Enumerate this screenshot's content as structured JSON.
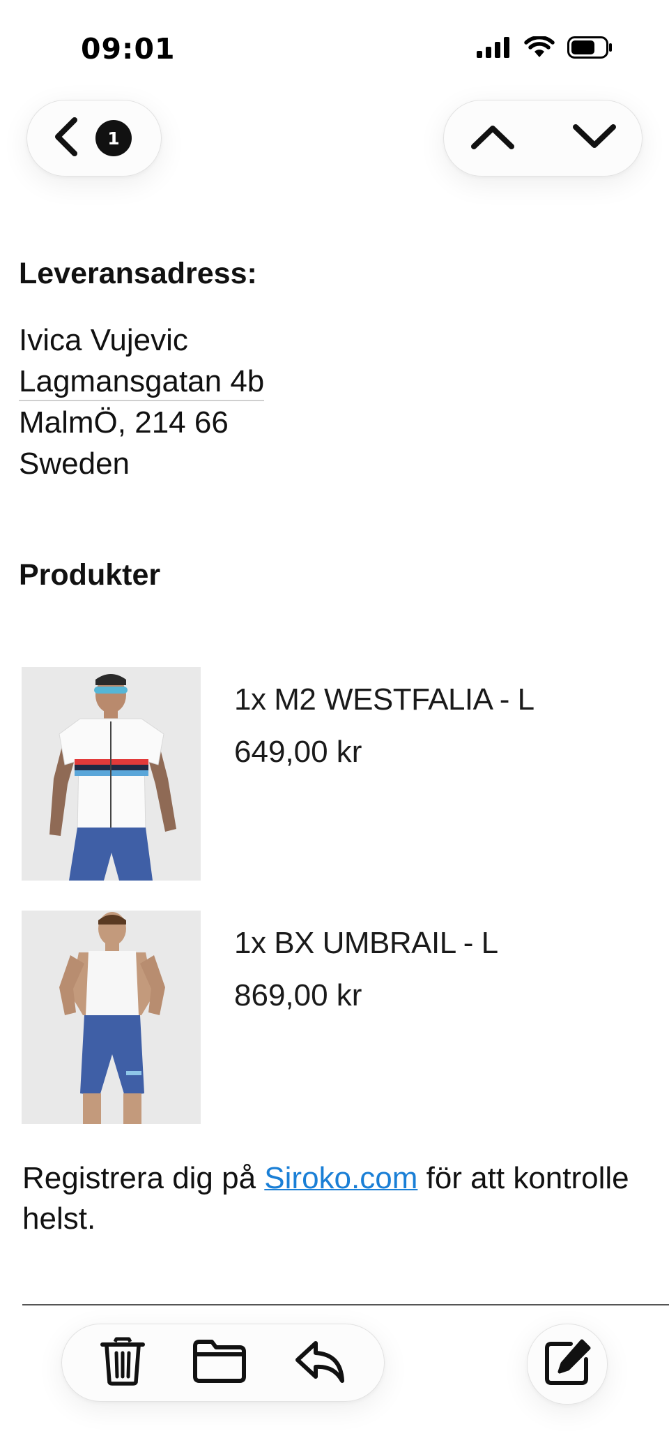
{
  "status_bar": {
    "time": "09:01"
  },
  "nav": {
    "back_icon": "chevron-left-icon",
    "unread_count": "1",
    "prev_icon": "chevron-up-icon",
    "next_icon": "chevron-down-icon"
  },
  "shipping": {
    "heading": "Leveransadress:",
    "name": "Ivica Vujevic",
    "street": "Lagmansgatan 4b",
    "city_zip": "MalmÖ, 214 66",
    "country": "Sweden"
  },
  "products": {
    "heading": "Produkter",
    "items": [
      {
        "title": "1x M2 WESTFALIA - L",
        "price": "649,00 kr"
      },
      {
        "title": "1x BX UMBRAIL - L",
        "price": "869,00 kr"
      }
    ]
  },
  "footer_text": {
    "before_link": "Registrera dig på ",
    "link": "Siroko.com",
    "after_link": " för att kontrolle",
    "line2": "helst."
  },
  "toolbar": {
    "icons": [
      "trash-icon",
      "folder-icon",
      "reply-icon",
      "compose-icon"
    ]
  },
  "colors": {
    "link": "#1a7fd6",
    "jersey_blue": "#3f5fa6",
    "background": "#ffffff"
  }
}
